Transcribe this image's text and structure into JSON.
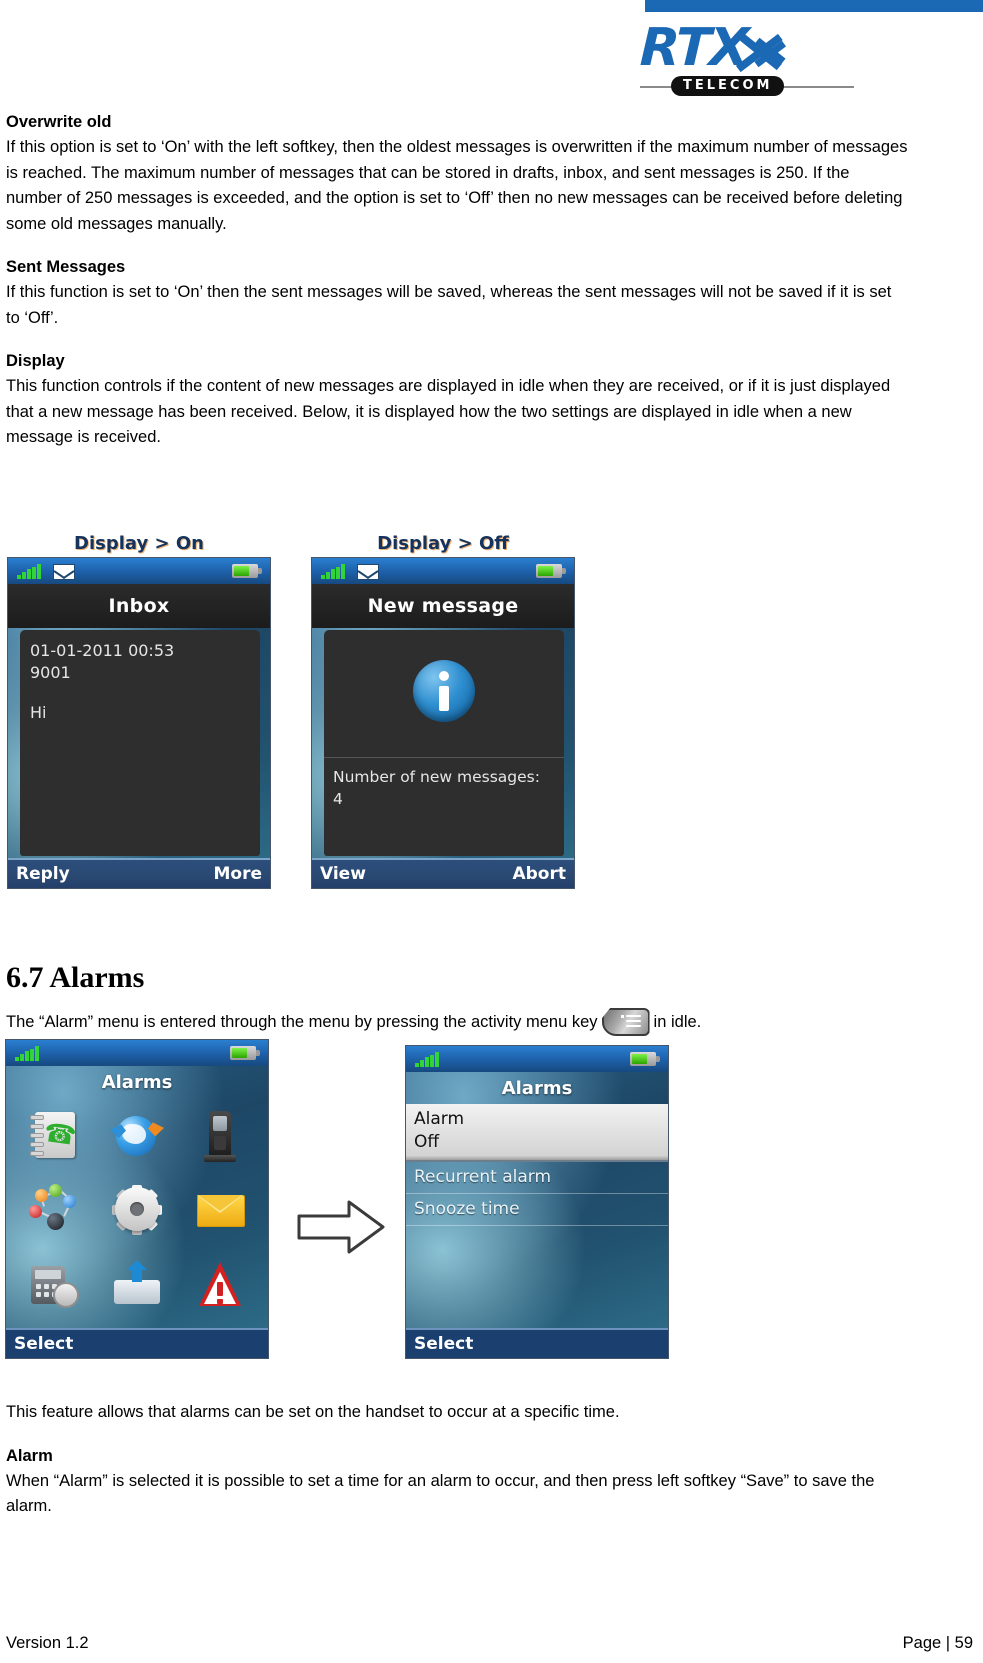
{
  "brand": {
    "logo_text": "RTX",
    "logo_sub": "TELECOM",
    "accent_color": "#1B68B4"
  },
  "sections": [
    {
      "heading": "Overwrite old",
      "body": "If this option is set to ‘On’ with the left softkey, then the oldest messages is overwritten if the maximum number of messages is reached.  The maximum number of messages that can be stored in drafts, inbox, and sent messages is 250. If the number of 250 messages is exceeded, and the option is set to ‘Off’ then no new messages can be received before deleting some old messages manually."
    },
    {
      "heading": "Sent Messages",
      "body": "If this function is set to ‘On’ then the sent messages will be saved, whereas the sent messages will not be saved if it is set to ‘Off’."
    },
    {
      "heading": "Display",
      "body": "This function controls if the content of new messages are displayed in idle when they are received, or if it is just displayed that a new message has been received. Below, it is displayed how the two settings are displayed in idle when a new message is received."
    }
  ],
  "figure_display": {
    "left": {
      "caption": "Display > On",
      "status_icons": [
        "signal-bars-icon",
        "envelope-icon",
        "battery-icon"
      ],
      "title": "Inbox",
      "message_date": "01-01-2011 00:53",
      "message_number": "9001",
      "message_body": "Hi",
      "softkey_left": "Reply",
      "softkey_right": "More"
    },
    "right": {
      "caption": "Display > Off",
      "status_icons": [
        "signal-bars-icon",
        "envelope-icon",
        "battery-icon"
      ],
      "title": "New message",
      "info_icon": "info-circle-icon",
      "info_text": "Number of new messages:",
      "info_count": "4",
      "softkey_left": "View",
      "softkey_right": "Abort"
    }
  },
  "alarms_section": {
    "number_title": "6.7 Alarms",
    "intro_before": "The “Alarm” menu is entered through the menu by pressing the activity menu key",
    "intro_icon": "activity-menu-key-icon",
    "intro_after": "in idle.",
    "menu_screen": {
      "title": "Alarms",
      "icons": [
        "phonebook-icon",
        "globe-internet-icon",
        "handset-icon",
        "network-connections-icon",
        "settings-gear-icon",
        "messages-envelope-icon",
        "calculator-stopwatch-icon",
        "inbox-tray-icon",
        "alarm-warning-icon"
      ],
      "softkey_left": "Select"
    },
    "list_screen": {
      "title": "Alarms",
      "selected_item": {
        "label": "Alarm",
        "value": "Off"
      },
      "items": [
        "Recurrent alarm",
        "Snooze time"
      ],
      "softkey_left": "Select"
    },
    "transition_icon": "right-arrow-icon",
    "feature_text": "This feature allows that alarms can be set on the handset to occur at a specific time.",
    "alarm_heading": "Alarm",
    "alarm_body": "When “Alarm” is selected it is possible to set a time for an alarm to occur, and then press left softkey “Save” to save the alarm."
  },
  "footer": {
    "version": "Version 1.2",
    "page": "Page | 59"
  }
}
